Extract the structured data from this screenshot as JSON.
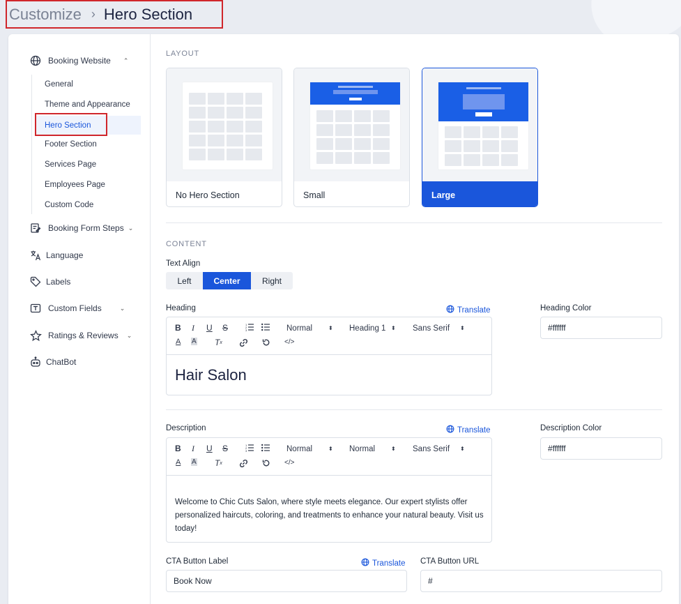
{
  "breadcrumb": {
    "parent": "Customize",
    "separator": "›",
    "current": "Hero Section"
  },
  "sidebar": {
    "booking_website": "Booking Website",
    "sub_items": [
      "General",
      "Theme and Appearance",
      "Hero Section",
      "Footer Section",
      "Services Page",
      "Employees Page",
      "Custom Code"
    ],
    "active_item": "Hero Section",
    "booking_form_steps": "Booking Form Steps",
    "language": "Language",
    "labels": "Labels",
    "custom_fields": "Custom Fields",
    "ratings_reviews": "Ratings & Reviews",
    "chatbot": "ChatBot"
  },
  "layout": {
    "section_label": "LAYOUT",
    "options": [
      "No Hero Section",
      "Small",
      "Large"
    ],
    "selected": "Large"
  },
  "content": {
    "section_label": "CONTENT",
    "text_align_label": "Text Align",
    "align_options": [
      "Left",
      "Center",
      "Right"
    ],
    "align_selected": "Center",
    "translate_label": "Translate",
    "heading_label": "Heading",
    "heading_toolbar": {
      "size": "Normal",
      "header": "Heading 1",
      "font": "Sans Serif"
    },
    "heading_value": "Hair Salon",
    "heading_color_label": "Heading Color",
    "heading_color_value": "#ffffff",
    "description_label": "Description",
    "description_toolbar": {
      "size": "Normal",
      "header": "Normal",
      "font": "Sans Serif"
    },
    "description_value": "Welcome to Chic Cuts Salon, where style meets elegance. Our expert stylists offer personalized haircuts, coloring, and treatments to enhance your natural beauty. Visit us today!",
    "description_color_label": "Description Color",
    "description_color_value": "#ffffff",
    "cta_label_label": "CTA Button Label",
    "cta_label_value": "Book Now",
    "cta_url_label": "CTA Button URL",
    "cta_url_value": "#"
  },
  "colors": {
    "accent": "#1a56db",
    "highlight": "#d0262b"
  }
}
